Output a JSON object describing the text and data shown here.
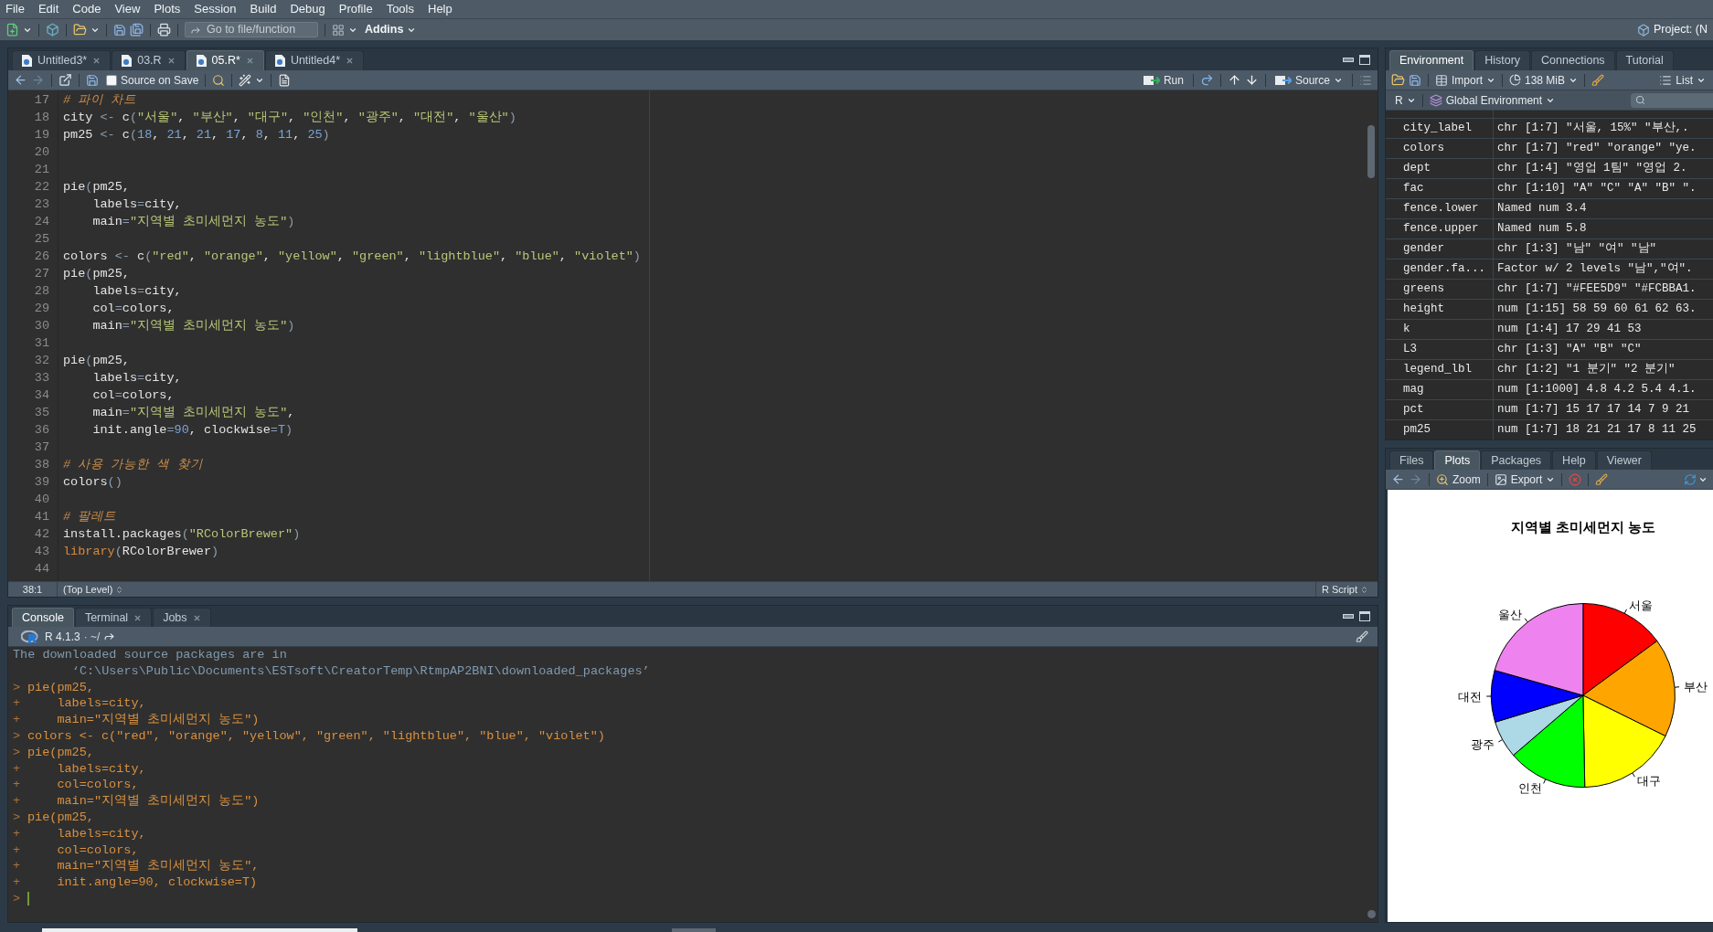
{
  "menu_bar": {
    "items": [
      "File",
      "Edit",
      "Code",
      "View",
      "Plots",
      "Session",
      "Build",
      "Debug",
      "Profile",
      "Tools",
      "Help"
    ]
  },
  "main_toolbar": {
    "go_to_file": {
      "placeholder": "Go to file/function"
    },
    "addins": "Addins",
    "project": "Project: (N"
  },
  "editor": {
    "tabs": [
      {
        "label": "Untitled3*",
        "selected": false,
        "closable": true
      },
      {
        "label": "03.R",
        "selected": false,
        "closable": true
      },
      {
        "label": "05.R*",
        "selected": true,
        "closable": true
      },
      {
        "label": "Untitled4*",
        "selected": false,
        "closable": true
      }
    ],
    "toolbar": {
      "source_on_save": {
        "label": "Source on Save",
        "checked": false
      },
      "run": "Run",
      "source": "Source"
    },
    "lines": [
      {
        "number": "17",
        "tokens": [
          {
            "kind": "comment",
            "text": "# 파이 차트"
          }
        ]
      },
      {
        "number": "18",
        "tokens": [
          {
            "kind": "plain",
            "text": "city "
          },
          {
            "kind": "operator",
            "text": "<-"
          },
          {
            "kind": "plain",
            "text": " c"
          },
          {
            "kind": "operator",
            "text": "("
          },
          {
            "kind": "string",
            "text": "\"서울\""
          },
          {
            "kind": "plain",
            "text": ", "
          },
          {
            "kind": "string",
            "text": "\"부산\""
          },
          {
            "kind": "plain",
            "text": ", "
          },
          {
            "kind": "string",
            "text": "\"대구\""
          },
          {
            "kind": "plain",
            "text": ", "
          },
          {
            "kind": "string",
            "text": "\"인천\""
          },
          {
            "kind": "plain",
            "text": ", "
          },
          {
            "kind": "string",
            "text": "\"광주\""
          },
          {
            "kind": "plain",
            "text": ", "
          },
          {
            "kind": "string",
            "text": "\"대전\""
          },
          {
            "kind": "plain",
            "text": ", "
          },
          {
            "kind": "string",
            "text": "\"울산\""
          },
          {
            "kind": "operator",
            "text": ")"
          }
        ]
      },
      {
        "number": "19",
        "tokens": [
          {
            "kind": "plain",
            "text": "pm25 "
          },
          {
            "kind": "operator",
            "text": "<-"
          },
          {
            "kind": "plain",
            "text": " c"
          },
          {
            "kind": "operator",
            "text": "("
          },
          {
            "kind": "number",
            "text": "18"
          },
          {
            "kind": "plain",
            "text": ", "
          },
          {
            "kind": "number",
            "text": "21"
          },
          {
            "kind": "plain",
            "text": ", "
          },
          {
            "kind": "number",
            "text": "21"
          },
          {
            "kind": "plain",
            "text": ", "
          },
          {
            "kind": "number",
            "text": "17"
          },
          {
            "kind": "plain",
            "text": ", "
          },
          {
            "kind": "number",
            "text": "8"
          },
          {
            "kind": "plain",
            "text": ", "
          },
          {
            "kind": "number",
            "text": "11"
          },
          {
            "kind": "plain",
            "text": ", "
          },
          {
            "kind": "number",
            "text": "25"
          },
          {
            "kind": "operator",
            "text": ")"
          }
        ]
      },
      {
        "number": "20"
      },
      {
        "number": "21"
      },
      {
        "number": "22",
        "tokens": [
          {
            "kind": "plain",
            "text": "pie"
          },
          {
            "kind": "operator",
            "text": "("
          },
          {
            "kind": "plain",
            "text": "pm25,"
          }
        ]
      },
      {
        "number": "23",
        "tokens": [
          {
            "kind": "plain",
            "text": "    labels"
          },
          {
            "kind": "operator",
            "text": "="
          },
          {
            "kind": "plain",
            "text": "city,"
          }
        ]
      },
      {
        "number": "24",
        "tokens": [
          {
            "kind": "plain",
            "text": "    main"
          },
          {
            "kind": "operator",
            "text": "="
          },
          {
            "kind": "string",
            "text": "\"지역별 초미세먼지 농도\""
          },
          {
            "kind": "operator",
            "text": ")"
          }
        ]
      },
      {
        "number": "25"
      },
      {
        "number": "26",
        "tokens": [
          {
            "kind": "plain",
            "text": "colors "
          },
          {
            "kind": "operator",
            "text": "<-"
          },
          {
            "kind": "plain",
            "text": " c"
          },
          {
            "kind": "operator",
            "text": "("
          },
          {
            "kind": "string",
            "text": "\"red\""
          },
          {
            "kind": "plain",
            "text": ", "
          },
          {
            "kind": "string",
            "text": "\"orange\""
          },
          {
            "kind": "plain",
            "text": ", "
          },
          {
            "kind": "string",
            "text": "\"yellow\""
          },
          {
            "kind": "plain",
            "text": ", "
          },
          {
            "kind": "string",
            "text": "\"green\""
          },
          {
            "kind": "plain",
            "text": ", "
          },
          {
            "kind": "string",
            "text": "\"lightblue\""
          },
          {
            "kind": "plain",
            "text": ", "
          },
          {
            "kind": "string",
            "text": "\"blue\""
          },
          {
            "kind": "plain",
            "text": ", "
          },
          {
            "kind": "string",
            "text": "\"violet\""
          },
          {
            "kind": "operator",
            "text": ")"
          }
        ]
      },
      {
        "number": "27",
        "tokens": [
          {
            "kind": "plain",
            "text": "pie"
          },
          {
            "kind": "operator",
            "text": "("
          },
          {
            "kind": "plain",
            "text": "pm25,"
          }
        ]
      },
      {
        "number": "28",
        "tokens": [
          {
            "kind": "plain",
            "text": "    labels"
          },
          {
            "kind": "operator",
            "text": "="
          },
          {
            "kind": "plain",
            "text": "city,"
          }
        ]
      },
      {
        "number": "29",
        "tokens": [
          {
            "kind": "plain",
            "text": "    col"
          },
          {
            "kind": "operator",
            "text": "="
          },
          {
            "kind": "plain",
            "text": "colors,"
          }
        ]
      },
      {
        "number": "30",
        "tokens": [
          {
            "kind": "plain",
            "text": "    main"
          },
          {
            "kind": "operator",
            "text": "="
          },
          {
            "kind": "string",
            "text": "\"지역별 초미세먼지 농도\""
          },
          {
            "kind": "operator",
            "text": ")"
          }
        ]
      },
      {
        "number": "31"
      },
      {
        "number": "32",
        "tokens": [
          {
            "kind": "plain",
            "text": "pie"
          },
          {
            "kind": "operator",
            "text": "("
          },
          {
            "kind": "plain",
            "text": "pm25,"
          }
        ]
      },
      {
        "number": "33",
        "tokens": [
          {
            "kind": "plain",
            "text": "    labels"
          },
          {
            "kind": "operator",
            "text": "="
          },
          {
            "kind": "plain",
            "text": "city,"
          }
        ]
      },
      {
        "number": "34",
        "tokens": [
          {
            "kind": "plain",
            "text": "    col"
          },
          {
            "kind": "operator",
            "text": "="
          },
          {
            "kind": "plain",
            "text": "colors,"
          }
        ]
      },
      {
        "number": "35",
        "tokens": [
          {
            "kind": "plain",
            "text": "    main"
          },
          {
            "kind": "operator",
            "text": "="
          },
          {
            "kind": "string",
            "text": "\"지역별 초미세먼지 농도\""
          },
          {
            "kind": "plain",
            "text": ","
          }
        ]
      },
      {
        "number": "36",
        "tokens": [
          {
            "kind": "plain",
            "text": "    init.angle"
          },
          {
            "kind": "operator",
            "text": "="
          },
          {
            "kind": "number",
            "text": "90"
          },
          {
            "kind": "plain",
            "text": ", clockwise"
          },
          {
            "kind": "operator",
            "text": "="
          },
          {
            "kind": "number",
            "text": "T"
          },
          {
            "kind": "operator",
            "text": ")"
          }
        ]
      },
      {
        "number": "37"
      },
      {
        "number": "38",
        "tokens": [
          {
            "kind": "comment",
            "text": "# 사용 가능한 색 찾기"
          }
        ]
      },
      {
        "number": "39",
        "tokens": [
          {
            "kind": "plain",
            "text": "colors"
          },
          {
            "kind": "operator",
            "text": "()"
          }
        ]
      },
      {
        "number": "40"
      },
      {
        "number": "41",
        "tokens": [
          {
            "kind": "comment",
            "text": "# 팔레트"
          }
        ]
      },
      {
        "number": "42",
        "tokens": [
          {
            "kind": "plain",
            "text": "install.packages"
          },
          {
            "kind": "operator",
            "text": "("
          },
          {
            "kind": "string",
            "text": "\"RColorBrewer\""
          },
          {
            "kind": "operator",
            "text": ")"
          }
        ]
      },
      {
        "number": "43",
        "tokens": [
          {
            "kind": "keyword",
            "text": "library"
          },
          {
            "kind": "operator",
            "text": "("
          },
          {
            "kind": "plain",
            "text": "RColorBrewer"
          },
          {
            "kind": "operator",
            "text": ")"
          }
        ]
      },
      {
        "number": "44"
      }
    ],
    "status_bar": {
      "position": "38:1",
      "scope": "(Top Level)",
      "file_type": "R Script"
    }
  },
  "console": {
    "tabs": [
      {
        "label": "Console",
        "selected": true,
        "closable": false
      },
      {
        "label": "Terminal",
        "selected": false,
        "closable": true
      },
      {
        "label": "Jobs",
        "selected": false,
        "closable": true
      }
    ],
    "version": "R 4.1.3",
    "working_directory": "· ~/",
    "lines": [
      {
        "kind": "output",
        "text": "The downloaded source packages are in"
      },
      {
        "kind": "output",
        "text": "        ‘C:\\Users\\Public\\Documents\\ESTsoft\\CreatorTemp\\RtmpAP2BNI\\downloaded_packages’"
      },
      {
        "kind": "input",
        "prompt": ">",
        "text": "pie(pm25,"
      },
      {
        "kind": "input",
        "prompt": "+",
        "text": "    labels=city,"
      },
      {
        "kind": "input",
        "prompt": "+",
        "text": "    main=\"지역별 초미세먼지 농도\")"
      },
      {
        "kind": "input",
        "prompt": ">",
        "text": "colors <- c(\"red\", \"orange\", \"yellow\", \"green\", \"lightblue\", \"blue\", \"violet\")"
      },
      {
        "kind": "input",
        "prompt": ">",
        "text": "pie(pm25,"
      },
      {
        "kind": "input",
        "prompt": "+",
        "text": "    labels=city,"
      },
      {
        "kind": "input",
        "prompt": "+",
        "text": "    col=colors,"
      },
      {
        "kind": "input",
        "prompt": "+",
        "text": "    main=\"지역별 초미세먼지 농도\")"
      },
      {
        "kind": "input",
        "prompt": ">",
        "text": "pie(pm25,"
      },
      {
        "kind": "input",
        "prompt": "+",
        "text": "    labels=city,"
      },
      {
        "kind": "input",
        "prompt": "+",
        "text": "    col=colors,"
      },
      {
        "kind": "input",
        "prompt": "+",
        "text": "    main=\"지역별 초미세먼지 농도\","
      },
      {
        "kind": "input",
        "prompt": "+",
        "text": "    init.angle=90, clockwise=T)"
      }
    ],
    "input_prompt": ">"
  },
  "environment": {
    "tabs": [
      {
        "label": "Environment",
        "selected": true
      },
      {
        "label": "History",
        "selected": false
      },
      {
        "label": "Connections",
        "selected": false
      },
      {
        "label": "Tutorial",
        "selected": false
      }
    ],
    "import": "Import",
    "memory": "138 MiB",
    "view": "List",
    "language": "R",
    "scope": "Global Environment",
    "rows": [
      {
        "name": "city_label",
        "value": "chr [1:7] \"서울, 15%\" \"부산,."
      },
      {
        "name": "colors",
        "value": "chr [1:7] \"red\" \"orange\" \"ye."
      },
      {
        "name": "dept",
        "value": "chr [1:4] \"영업 1팀\" \"영업 2."
      },
      {
        "name": "fac",
        "value": "chr [1:10] \"A\" \"C\" \"A\" \"B\" \"."
      },
      {
        "name": "fence.lower",
        "value": "Named num 3.4"
      },
      {
        "name": "fence.upper",
        "value": "Named num 5.8"
      },
      {
        "name": "gender",
        "value": "chr [1:3] \"남\" \"여\" \"남\""
      },
      {
        "name": "gender.fa...",
        "value": "Factor w/ 2 levels \"남\",\"여\"."
      },
      {
        "name": "greens",
        "value": "chr [1:7] \"#FEE5D9\" \"#FCBBA1."
      },
      {
        "name": "height",
        "value": "num [1:15] 58 59 60 61 62 63."
      },
      {
        "name": "k",
        "value": "num [1:4] 17 29 41 53"
      },
      {
        "name": "L3",
        "value": "chr [1:3] \"A\" \"B\" \"C\""
      },
      {
        "name": "legend_lbl",
        "value": "chr [1:2] \"1 분기\" \"2 분기\""
      },
      {
        "name": "mag",
        "value": "num [1:1000] 4.8 4.2 5.4 4.1."
      },
      {
        "name": "pct",
        "value": "num [1:7] 15 17 17 14 7 9 21"
      },
      {
        "name": "pm25",
        "value": "num [1:7] 18 21 21 17 8 11 25"
      }
    ]
  },
  "plots": {
    "tabs": [
      {
        "label": "Files",
        "selected": false
      },
      {
        "label": "Plots",
        "selected": true
      },
      {
        "label": "Packages",
        "selected": false
      },
      {
        "label": "Help",
        "selected": false
      },
      {
        "label": "Viewer",
        "selected": false
      }
    ],
    "zoom": "Zoom",
    "export": "Export",
    "chart_data": {
      "type": "pie",
      "title": "지역별 초미세먼지 농도",
      "categories": [
        "서울",
        "부산",
        "대구",
        "인천",
        "광주",
        "대전",
        "울산"
      ],
      "values": [
        14.9,
        17.4,
        17.4,
        14.0,
        6.6,
        9.1,
        20.6
      ],
      "colors": [
        "#ff0000",
        "#ffa500",
        "#ffff00",
        "#00ff00",
        "#add8e6",
        "#0000ff",
        "#ee82ee"
      ]
    }
  }
}
